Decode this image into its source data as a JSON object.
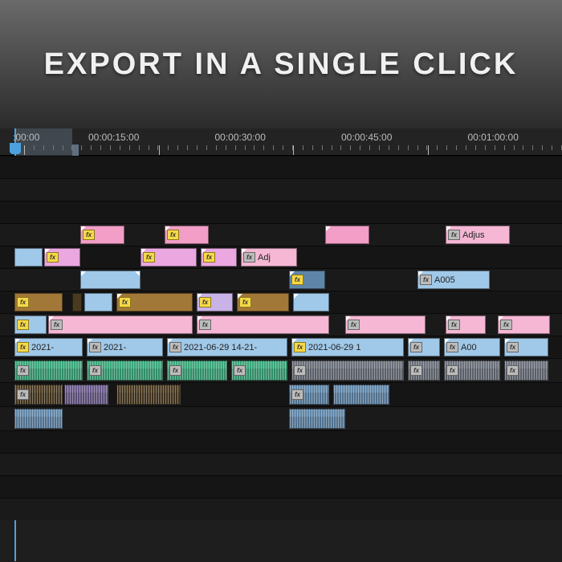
{
  "banner": {
    "title": "EXPORT IN A SINGLE CLICK"
  },
  "ruler": {
    "start": ":00:00",
    "marks": [
      "00:00:15:00",
      "00:00:30:00",
      "00:00:45:00",
      "00:01:00:00"
    ]
  },
  "fx": {
    "label": "fx"
  },
  "clips": {
    "adjust": "Adjus",
    "adj": "Adj",
    "a005": "A005",
    "date1": "2021-",
    "date2": "2021-",
    "date3": "2021-06-29 14-21-",
    "date4": "2021-06-29 1",
    "a00": "A00"
  }
}
